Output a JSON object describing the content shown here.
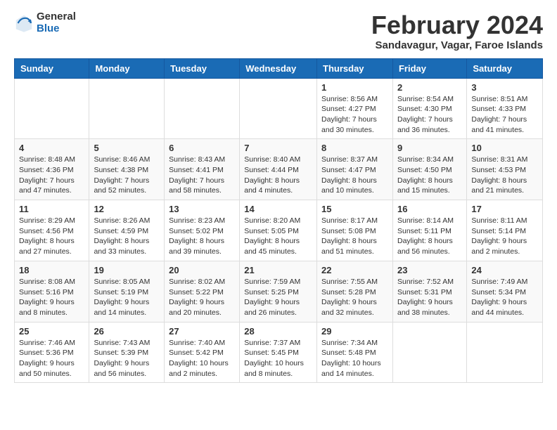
{
  "header": {
    "logo_general": "General",
    "logo_blue": "Blue",
    "month_title": "February 2024",
    "subtitle": "Sandavagur, Vagar, Faroe Islands"
  },
  "days_of_week": [
    "Sunday",
    "Monday",
    "Tuesday",
    "Wednesday",
    "Thursday",
    "Friday",
    "Saturday"
  ],
  "weeks": [
    [
      {
        "day": "",
        "info": ""
      },
      {
        "day": "",
        "info": ""
      },
      {
        "day": "",
        "info": ""
      },
      {
        "day": "",
        "info": ""
      },
      {
        "day": "1",
        "info": "Sunrise: 8:56 AM\nSunset: 4:27 PM\nDaylight: 7 hours\nand 30 minutes."
      },
      {
        "day": "2",
        "info": "Sunrise: 8:54 AM\nSunset: 4:30 PM\nDaylight: 7 hours\nand 36 minutes."
      },
      {
        "day": "3",
        "info": "Sunrise: 8:51 AM\nSunset: 4:33 PM\nDaylight: 7 hours\nand 41 minutes."
      }
    ],
    [
      {
        "day": "4",
        "info": "Sunrise: 8:48 AM\nSunset: 4:36 PM\nDaylight: 7 hours\nand 47 minutes."
      },
      {
        "day": "5",
        "info": "Sunrise: 8:46 AM\nSunset: 4:38 PM\nDaylight: 7 hours\nand 52 minutes."
      },
      {
        "day": "6",
        "info": "Sunrise: 8:43 AM\nSunset: 4:41 PM\nDaylight: 7 hours\nand 58 minutes."
      },
      {
        "day": "7",
        "info": "Sunrise: 8:40 AM\nSunset: 4:44 PM\nDaylight: 8 hours\nand 4 minutes."
      },
      {
        "day": "8",
        "info": "Sunrise: 8:37 AM\nSunset: 4:47 PM\nDaylight: 8 hours\nand 10 minutes."
      },
      {
        "day": "9",
        "info": "Sunrise: 8:34 AM\nSunset: 4:50 PM\nDaylight: 8 hours\nand 15 minutes."
      },
      {
        "day": "10",
        "info": "Sunrise: 8:31 AM\nSunset: 4:53 PM\nDaylight: 8 hours\nand 21 minutes."
      }
    ],
    [
      {
        "day": "11",
        "info": "Sunrise: 8:29 AM\nSunset: 4:56 PM\nDaylight: 8 hours\nand 27 minutes."
      },
      {
        "day": "12",
        "info": "Sunrise: 8:26 AM\nSunset: 4:59 PM\nDaylight: 8 hours\nand 33 minutes."
      },
      {
        "day": "13",
        "info": "Sunrise: 8:23 AM\nSunset: 5:02 PM\nDaylight: 8 hours\nand 39 minutes."
      },
      {
        "day": "14",
        "info": "Sunrise: 8:20 AM\nSunset: 5:05 PM\nDaylight: 8 hours\nand 45 minutes."
      },
      {
        "day": "15",
        "info": "Sunrise: 8:17 AM\nSunset: 5:08 PM\nDaylight: 8 hours\nand 51 minutes."
      },
      {
        "day": "16",
        "info": "Sunrise: 8:14 AM\nSunset: 5:11 PM\nDaylight: 8 hours\nand 56 minutes."
      },
      {
        "day": "17",
        "info": "Sunrise: 8:11 AM\nSunset: 5:14 PM\nDaylight: 9 hours\nand 2 minutes."
      }
    ],
    [
      {
        "day": "18",
        "info": "Sunrise: 8:08 AM\nSunset: 5:16 PM\nDaylight: 9 hours\nand 8 minutes."
      },
      {
        "day": "19",
        "info": "Sunrise: 8:05 AM\nSunset: 5:19 PM\nDaylight: 9 hours\nand 14 minutes."
      },
      {
        "day": "20",
        "info": "Sunrise: 8:02 AM\nSunset: 5:22 PM\nDaylight: 9 hours\nand 20 minutes."
      },
      {
        "day": "21",
        "info": "Sunrise: 7:59 AM\nSunset: 5:25 PM\nDaylight: 9 hours\nand 26 minutes."
      },
      {
        "day": "22",
        "info": "Sunrise: 7:55 AM\nSunset: 5:28 PM\nDaylight: 9 hours\nand 32 minutes."
      },
      {
        "day": "23",
        "info": "Sunrise: 7:52 AM\nSunset: 5:31 PM\nDaylight: 9 hours\nand 38 minutes."
      },
      {
        "day": "24",
        "info": "Sunrise: 7:49 AM\nSunset: 5:34 PM\nDaylight: 9 hours\nand 44 minutes."
      }
    ],
    [
      {
        "day": "25",
        "info": "Sunrise: 7:46 AM\nSunset: 5:36 PM\nDaylight: 9 hours\nand 50 minutes."
      },
      {
        "day": "26",
        "info": "Sunrise: 7:43 AM\nSunset: 5:39 PM\nDaylight: 9 hours\nand 56 minutes."
      },
      {
        "day": "27",
        "info": "Sunrise: 7:40 AM\nSunset: 5:42 PM\nDaylight: 10 hours\nand 2 minutes."
      },
      {
        "day": "28",
        "info": "Sunrise: 7:37 AM\nSunset: 5:45 PM\nDaylight: 10 hours\nand 8 minutes."
      },
      {
        "day": "29",
        "info": "Sunrise: 7:34 AM\nSunset: 5:48 PM\nDaylight: 10 hours\nand 14 minutes."
      },
      {
        "day": "",
        "info": ""
      },
      {
        "day": "",
        "info": ""
      }
    ]
  ]
}
